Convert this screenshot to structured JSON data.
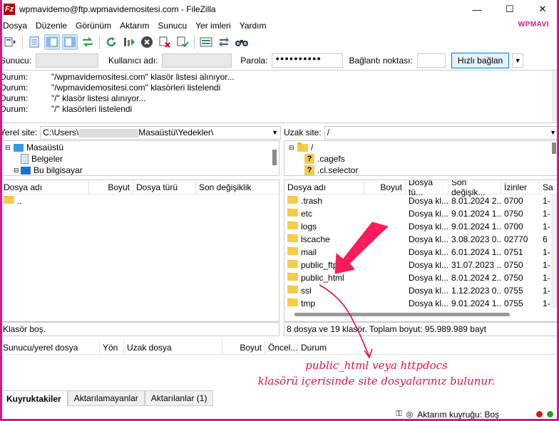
{
  "window": {
    "title": "wpmavidemo@ftp.wpmavidemositesi.com - FileZilla",
    "app_icon": "Fz",
    "min": "—",
    "max": "☐",
    "close": "✕"
  },
  "brand": {
    "logo": "WPMAVI",
    "accent": "#d31a8a"
  },
  "menu": [
    "Dosya",
    "Düzenle",
    "Görünüm",
    "Aktarım",
    "Sunucu",
    "Yer imleri",
    "Yardım"
  ],
  "quick": {
    "host_label": "Sunucu:",
    "user_label": "Kullanıcı adı:",
    "pass_label": "Parola:",
    "pass_value": "●●●●●●●●●●",
    "port_label": "Bağlantı noktası:",
    "connect_label": "Hızlı bağlan"
  },
  "log": [
    {
      "k": "Durum:",
      "v": "\"/wpmavidemositesi.com\" klasör listesi alınıyor..."
    },
    {
      "k": "Durum:",
      "v": "\"/wpmavidemositesi.com\" klasörleri listelendi"
    },
    {
      "k": "Durum:",
      "v": "\"/\" klasör listesi alınıyor..."
    },
    {
      "k": "Durum:",
      "v": "\"/\" klasörleri listelendi"
    }
  ],
  "local": {
    "label": "Yerel site:",
    "path_start": "C:\\Users\\",
    "path_end": "Masaüstü\\Yedekler\\",
    "tree": [
      "Masaüstü",
      "Belgeler",
      "Bu bilgisayar"
    ],
    "cols": [
      "Dosya adı",
      "Boyut",
      "Dosya türü",
      "Son değişiklik"
    ],
    "files": [
      ".."
    ],
    "status": "Klasör boş."
  },
  "remote": {
    "label": "Uzak site:",
    "path": "/",
    "tree": [
      "/",
      ".cagefs",
      ".cl.selector"
    ],
    "cols": [
      "Dosya adı",
      "Boyut",
      "Dosya tü...",
      "Son değişik...",
      "İzinler",
      "Sa"
    ],
    "files": [
      {
        "name": ".trash",
        "type": "Dosya kl...",
        "date": "8.01.2024 2...",
        "perm": "0700",
        "o": "1-"
      },
      {
        "name": "etc",
        "type": "Dosya kl...",
        "date": "9.01.2024 1...",
        "perm": "0750",
        "o": "1-"
      },
      {
        "name": "logs",
        "type": "Dosya kl...",
        "date": "9.01.2024 1...",
        "perm": "0700",
        "o": "1-"
      },
      {
        "name": "lscache",
        "type": "Dosya kl...",
        "date": "3.08.2023 0...",
        "perm": "02770",
        "o": "6"
      },
      {
        "name": "mail",
        "type": "Dosya kl...",
        "date": "6.01.2024 1...",
        "perm": "0751",
        "o": "1-"
      },
      {
        "name": "public_ftp",
        "type": "Dosya kl...",
        "date": "31.07.2023 ...",
        "perm": "0750",
        "o": "1-"
      },
      {
        "name": "public_html",
        "type": "Dosya kl...",
        "date": "8.01.2024 2...",
        "perm": "0750",
        "o": "1-"
      },
      {
        "name": "ssl",
        "type": "Dosya kl...",
        "date": "1.12.2023 0...",
        "perm": "0755",
        "o": "1-"
      },
      {
        "name": "tmp",
        "type": "Dosya kl...",
        "date": "9.01.2024 1...",
        "perm": "0755",
        "o": "1-"
      }
    ],
    "status": "8 dosya ve 19 klasör. Toplam boyut: 95.989.989 bayt"
  },
  "queue": {
    "cols": [
      "Sunucu/yerel dosya",
      "Yön",
      "Uzak dosya",
      "Boyut",
      "Öncel...",
      "Durum"
    ]
  },
  "tabs": [
    "Kuyruktakiler",
    "Aktarılamayanlar",
    "Aktarılanlar (1)"
  ],
  "statusbar": {
    "queue": "Aktarım kuyruğu: Boş"
  },
  "annotation": {
    "line1": "public_html veya httpdocs",
    "line2": "klasörü içerisinde site dosyalarınız bulunur.",
    "color": "#e0144c"
  }
}
